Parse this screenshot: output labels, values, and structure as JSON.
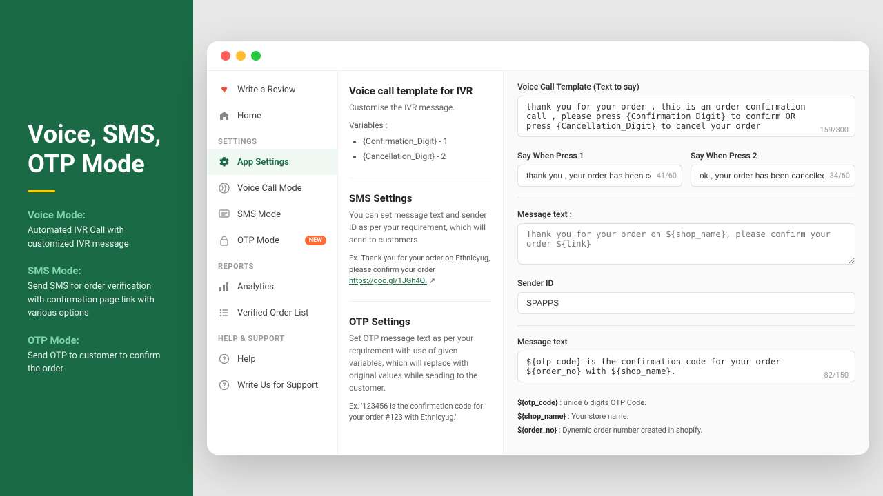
{
  "hero": {
    "title": "Voice, SMS, OTP Mode",
    "divider": true,
    "sections": [
      {
        "id": "voice",
        "heading": "Voice Mode:",
        "text": "Automated IVR Call with customized IVR message"
      },
      {
        "id": "sms",
        "heading": "SMS Mode:",
        "text": "Send SMS for order verification with confirmation page link with various options"
      },
      {
        "id": "otp",
        "heading": "OTP Mode:",
        "text": "Send OTP to customer to confirm the order"
      }
    ]
  },
  "sidebar": {
    "top_items": [
      {
        "id": "write-review",
        "label": "Write a Review",
        "icon": "heart"
      },
      {
        "id": "home",
        "label": "Home",
        "icon": "home"
      }
    ],
    "settings_label": "SETTINGS",
    "settings_items": [
      {
        "id": "app-settings",
        "label": "App Settings",
        "icon": "gear",
        "active": true
      },
      {
        "id": "voice-call-mode",
        "label": "Voice Call Mode",
        "icon": "phone"
      },
      {
        "id": "sms-mode",
        "label": "SMS Mode",
        "icon": "sms"
      },
      {
        "id": "otp-mode",
        "label": "OTP Mode",
        "icon": "lock",
        "badge": "New"
      }
    ],
    "reports_label": "REPORTS",
    "reports_items": [
      {
        "id": "analytics",
        "label": "Analytics",
        "icon": "chart"
      },
      {
        "id": "verified-order-list",
        "label": "Verified Order List",
        "icon": "list"
      }
    ],
    "help_label": "HELP & SUPPORT",
    "help_items": [
      {
        "id": "help",
        "label": "Help",
        "icon": "question"
      },
      {
        "id": "write-support",
        "label": "Write Us for Support",
        "icon": "question-circle"
      }
    ]
  },
  "voice_section": {
    "title": "Voice call template for IVR",
    "desc": "Customise the IVR message.",
    "vars_label": "Variables :",
    "variables": [
      "{Confirmation_Digit} - 1",
      "{Cancellation_Digit} - 2"
    ]
  },
  "sms_section": {
    "title": "SMS Settings",
    "desc": "You can set message text and sender ID as per your requirement, which will send to customers.",
    "example": "Ex. Thank you for your order on Ethnicyug, please confirm your order",
    "link_text": "https://goo.gl/1JGh4Q.",
    "link_icon": "↗"
  },
  "otp_section": {
    "title": "OTP Settings",
    "desc": "Set OTP message text as per your requirement with use of given variables, which will replace with original values while sending to the customer.",
    "example": "Ex. '123456 is the confirmation code for your order #123 with Ethnicyug.'"
  },
  "right_panel": {
    "voice_template_label": "Voice Call Template (Text to say)",
    "voice_template_value": "thank you for your order , this is an order confirmation call , please press {Confirmation_Digit} to confirm OR press {Cancellation_Digit} to cancel your order",
    "voice_template_char": "159/300",
    "say_when_press1_label": "Say When Press 1",
    "say_when_press1_value": "thank you , your order has been confirm",
    "say_when_press1_char": "41/60",
    "say_when_press2_label": "Say When Press 2",
    "say_when_press2_value": "ok , your order has been cancelled",
    "say_when_press2_char": "34/60",
    "sms_message_label": "Message text :",
    "sms_message_placeholder": "Thank you for your order on ${shop_name}, please confirm your order ${link}",
    "sender_id_label": "Sender ID",
    "sender_id_value": "SPAPPS",
    "otp_message_label": "Message text",
    "otp_message_value": "${otp_code} is the confirmation code for your order ${order_no} with ${shop_name}.",
    "otp_message_char": "82/150",
    "var_help": [
      {
        "var": "${otp_code}",
        "desc": ": uniqe 6 digits OTP Code."
      },
      {
        "var": "${shop_name}",
        "desc": ": Your store name."
      },
      {
        "var": "${order_no}",
        "desc": ": Dynemic order number created in shopify."
      }
    ]
  }
}
